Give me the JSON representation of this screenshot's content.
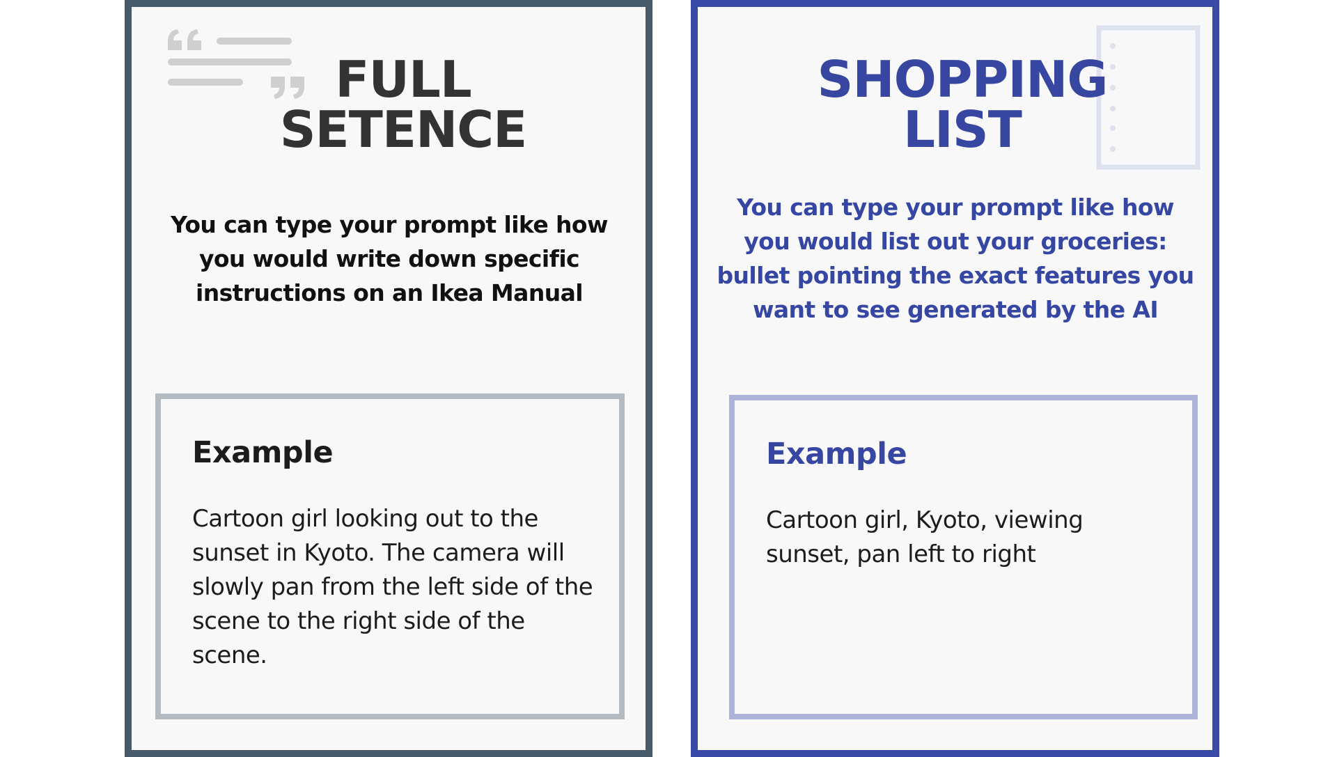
{
  "left_card": {
    "title_line1": "FULL",
    "title_line2": "SETENCE",
    "description": "You can type your prompt like how you would write down specific instructions on an Ikea Manual",
    "example_heading": "Example",
    "example_text": "Cartoon girl looking out to the sunset in Kyoto. The camera will slowly pan from the left side of the scene to the right side of the scene.",
    "decoration_icon": "quote-lines-icon",
    "border_color": "#465a6a"
  },
  "right_card": {
    "title_line1": "SHOPPING",
    "title_line2": "LIST",
    "description": "You can type your prompt like how you would list out your groceries: bullet pointing the exact features you want to see generated by the AI",
    "example_heading": "Example",
    "example_text": "Cartoon girl, Kyoto, viewing sunset, pan left to right",
    "decoration_icon": "notepad-icon",
    "border_color": "#3949a6",
    "accent_color": "#3646a1"
  }
}
